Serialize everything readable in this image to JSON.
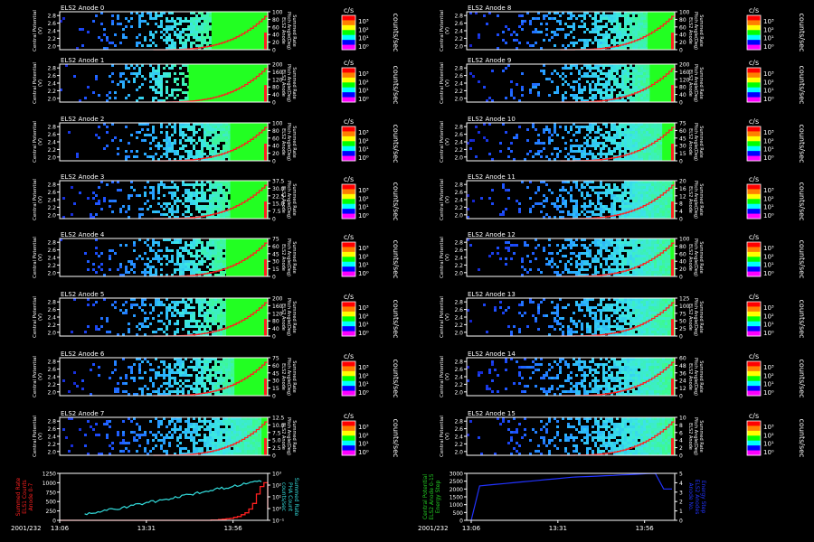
{
  "colors": {
    "background": "#000000",
    "axis": "#ffffff",
    "stair_line": "#ff2020",
    "bottom_left_primary": "#ff2020",
    "bottom_left_secondary": "#33dddd",
    "bottom_right_primary": "#22cc22",
    "bottom_right_secondary": "#2233ff",
    "colorbar_scale": [
      "#ff00ff",
      "#0000ff",
      "#00ffff",
      "#00ff00",
      "#ffff00",
      "#ff8000",
      "#ff0000"
    ]
  },
  "common": {
    "ylabel_left": "Central Potential",
    "ylabel_left_2": "(V)",
    "ylabel_right_top": "Summed Rate",
    "ylabel_right_mid": "Pitch Angle(Deg)",
    "ylabel_right_bot": "ELS2 Anode",
    "yticks": [
      "2.0",
      "2.2",
      "2.4",
      "2.6",
      "2.8"
    ],
    "colorbar_unit": "c/s",
    "colorbar_ticks": [
      "10³",
      "10²",
      "10¹",
      "10⁰"
    ],
    "counts_label": "counts/sec"
  },
  "chart_data": [
    {
      "type": "heatmap",
      "title": "ELS2 Anode 0",
      "y_range": [
        1.8,
        2.8
      ],
      "right_ticks": [
        "100",
        "80",
        "60",
        "40",
        "20",
        "0"
      ],
      "green_start": 0.73
    },
    {
      "type": "heatmap",
      "title": "ELS2 Anode 1",
      "y_range": [
        1.8,
        2.8
      ],
      "right_ticks": [
        "200",
        "160",
        "120",
        "80",
        "40",
        "0"
      ],
      "green_start": 0.62
    },
    {
      "type": "heatmap",
      "title": "ELS2 Anode 2",
      "y_range": [
        1.8,
        2.8
      ],
      "right_ticks": [
        "100",
        "80",
        "60",
        "40",
        "20",
        "0"
      ],
      "green_start": 0.82
    },
    {
      "type": "heatmap",
      "title": "ELS2 Anode 3",
      "y_range": [
        1.8,
        2.8
      ],
      "right_ticks": [
        "37.5",
        "30.0",
        "22.5",
        "15.0",
        "7.5",
        "0"
      ],
      "green_start": 0.82
    },
    {
      "type": "heatmap",
      "title": "ELS2 Anode 4",
      "y_range": [
        1.8,
        2.8
      ],
      "right_ticks": [
        "75",
        "60",
        "45",
        "30",
        "15",
        "0"
      ],
      "green_start": 0.8
    },
    {
      "type": "heatmap",
      "title": "ELS2 Anode 5",
      "y_range": [
        1.8,
        2.8
      ],
      "right_ticks": [
        "200",
        "160",
        "120",
        "80",
        "40",
        "0"
      ],
      "green_start": 0.8
    },
    {
      "type": "heatmap",
      "title": "ELS2 Anode 6",
      "y_range": [
        1.8,
        2.8
      ],
      "right_ticks": [
        "75",
        "60",
        "45",
        "30",
        "15",
        "0"
      ],
      "green_start": 0.84
    },
    {
      "type": "heatmap",
      "title": "ELS2 Anode 7",
      "y_range": [
        1.8,
        2.8
      ],
      "right_ticks": [
        "12.5",
        "10.0",
        "7.5",
        "5.0",
        "2.5",
        "0"
      ],
      "green_start": 0.97
    },
    {
      "type": "heatmap",
      "title": "ELS2 Anode 8",
      "y_range": [
        1.8,
        2.8
      ],
      "right_ticks": [
        "100",
        "80",
        "60",
        "40",
        "20",
        "0"
      ],
      "green_start": 0.87
    },
    {
      "type": "heatmap",
      "title": "ELS2 Anode 9",
      "y_range": [
        1.8,
        2.8
      ],
      "right_ticks": [
        "200",
        "160",
        "120",
        "80",
        "40",
        "0"
      ],
      "green_start": 0.88
    },
    {
      "type": "heatmap",
      "title": "ELS2 Anode 10",
      "y_range": [
        1.8,
        2.8
      ],
      "right_ticks": [
        "75",
        "60",
        "45",
        "30",
        "15",
        "0"
      ],
      "green_start": 0.94
    },
    {
      "type": "heatmap",
      "title": "ELS2 Anode 11",
      "y_range": [
        1.8,
        2.8
      ],
      "right_ticks": [
        "20",
        "16",
        "12",
        "8",
        "4",
        "0"
      ],
      "green_start": 0.99
    },
    {
      "type": "heatmap",
      "title": "ELS2 Anode 12",
      "y_range": [
        1.8,
        2.8
      ],
      "right_ticks": [
        "100",
        "80",
        "60",
        "40",
        "20",
        "0"
      ],
      "green_start": 0.98
    },
    {
      "type": "heatmap",
      "title": "ELS2 Anode 13",
      "y_range": [
        1.8,
        2.8
      ],
      "right_ticks": [
        "125",
        "100",
        "75",
        "50",
        "25",
        "0"
      ],
      "green_start": 0.99
    },
    {
      "type": "heatmap",
      "title": "ELS2 Anode 14",
      "y_range": [
        1.8,
        2.8
      ],
      "right_ticks": [
        "60",
        "48",
        "36",
        "24",
        "12",
        "0"
      ],
      "green_start": 0.99
    },
    {
      "type": "heatmap",
      "title": "ELS2 Anode 15",
      "y_range": [
        1.8,
        2.8
      ],
      "right_ticks": [
        "10",
        "8",
        "6",
        "4",
        "2",
        "0"
      ],
      "green_start": 0.99
    }
  ],
  "bottom_left": {
    "type": "line",
    "yticks_left": [
      "1250",
      "1000",
      "750",
      "500",
      "250",
      "0"
    ],
    "yticks_right": [
      "10³",
      "10²",
      "10¹",
      "10⁰",
      "10⁻¹"
    ],
    "ylabel_left": "Summed Rate",
    "ylabel_left_2": "ELS1 Counts",
    "ylabel_left_3": "Anode 0-7",
    "ylabel_right": "Summed Rate",
    "ylabel_right_2": "PHA Count",
    "ylabel_right_3": "counts/sec",
    "xticks": [
      "13:06",
      "13:31",
      "13:56"
    ],
    "date_label": "2001/232",
    "steps": [
      0,
      0,
      0,
      0,
      0,
      0,
      0,
      0,
      0,
      0,
      0,
      0,
      0,
      0,
      0,
      0,
      0,
      0,
      0,
      0,
      0,
      0,
      0,
      0,
      0,
      0,
      0,
      0,
      0,
      0,
      0,
      0,
      0,
      0,
      0,
      0,
      0,
      0,
      0,
      0,
      10,
      10,
      20,
      30,
      40,
      50,
      80,
      100,
      150,
      200,
      300,
      450,
      700,
      900,
      1000,
      300
    ]
  },
  "bottom_right": {
    "type": "line",
    "yticks_left": [
      "3000",
      "2500",
      "2000",
      "1500",
      "1000",
      "500",
      "0"
    ],
    "yticks_right": [
      "5",
      "4",
      "3",
      "2",
      "1",
      "0"
    ],
    "ylabel_left": "Central Potential",
    "ylabel_left_2": "ELS2 Anode 0-15",
    "ylabel_left_3": "Energy Step",
    "ylabel_right": "Energy Step",
    "ylabel_right_2": "ELS2 Anodes",
    "ylabel_right_3": "Anode No.",
    "xticks": [
      "13:06",
      "13:31",
      "13:56"
    ],
    "date_label": "2001/232",
    "values": [
      0,
      2200,
      2250,
      2300,
      2350,
      2400,
      2450,
      2500,
      2550,
      2600,
      2650,
      2700,
      2750,
      2780,
      2800,
      2820,
      2850,
      2870,
      2900,
      2920,
      2950,
      2980,
      3000,
      2000,
      2000
    ]
  }
}
